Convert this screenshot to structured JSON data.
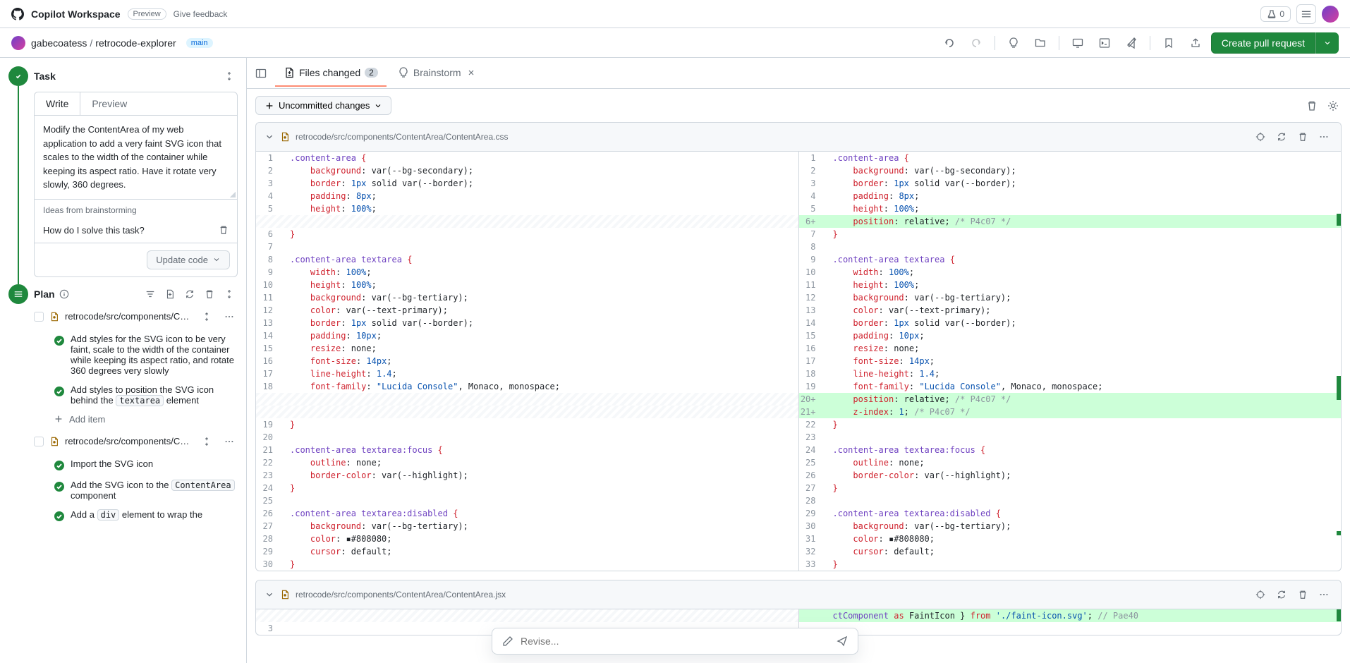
{
  "topbar": {
    "product": "Copilot Workspace",
    "preview_badge": "Preview",
    "feedback": "Give feedback",
    "experiments_count": "0"
  },
  "repo": {
    "owner": "gabecoatess",
    "name": "retrocode-explorer",
    "branch": "main",
    "pr_button": "Create pull request"
  },
  "task": {
    "section_label": "Task",
    "tab_write": "Write",
    "tab_preview": "Preview",
    "body": "Modify the ContentArea of my web application to add a very faint SVG icon that scales to the width of the container while keeping its aspect ratio. Have it rotate very slowly, 360 degrees.",
    "ideas_header": "Ideas from brainstorming",
    "idea_1": "How do I solve this task?",
    "update_code": "Update code"
  },
  "plan": {
    "section_label": "Plan",
    "files": [
      {
        "path": "retrocode/src/components/Content/",
        "items": [
          {
            "text_before": "Add styles for the SVG icon to be very faint, scale to the width of the container while keeping its aspect ratio, and rotate 360 degrees very slowly"
          },
          {
            "text_before": "Add styles to position the SVG icon behind the ",
            "code": "textarea",
            "text_after": " element"
          }
        ]
      },
      {
        "path": "retrocode/src/components/Content/",
        "items": [
          {
            "text_before": "Import the SVG icon"
          },
          {
            "text_before": "Add the SVG icon to the ",
            "code": "ContentArea",
            "text_after": " component"
          },
          {
            "text_before": "Add a ",
            "code": "div",
            "text_after": " element to wrap the"
          }
        ]
      }
    ],
    "add_item": "Add item"
  },
  "right": {
    "tab_files": "Files changed",
    "tab_files_count": "2",
    "tab_brainstorm": "Brainstorm",
    "uncommitted": "Uncommitted changes",
    "file1_path": "retrocode/src/components/ContentArea/ContentArea.css",
    "file2_path": "retrocode/src/components/ContentArea/ContentArea.jsx",
    "revise_placeholder": "Revise..."
  },
  "diff_file1": {
    "left": [
      {
        "n": 1,
        "html": "<span class='css-sel'>.content-area</span> <span class='css-brace-red'>{</span>"
      },
      {
        "n": 2,
        "html": "    <span class='css-prop'>background</span>: var(--bg-secondary);"
      },
      {
        "n": 3,
        "html": "    <span class='css-prop'>border</span>: <span class='css-num'>1px</span> solid var(--border);"
      },
      {
        "n": 4,
        "html": "    <span class='css-prop'>padding</span>: <span class='css-num'>8px</span>;"
      },
      {
        "n": 5,
        "html": "    <span class='css-prop'>height</span>: <span class='css-num'>100%</span>;"
      },
      {
        "n": "",
        "html": "",
        "hunk": true
      },
      {
        "n": 6,
        "html": "<span class='css-brace-red'>}</span>"
      },
      {
        "n": 7,
        "html": ""
      },
      {
        "n": 8,
        "html": "<span class='css-sel'>.content-area textarea</span> <span class='css-brace-red'>{</span>"
      },
      {
        "n": 9,
        "html": "    <span class='css-prop'>width</span>: <span class='css-num'>100%</span>;"
      },
      {
        "n": 10,
        "html": "    <span class='css-prop'>height</span>: <span class='css-num'>100%</span>;"
      },
      {
        "n": 11,
        "html": "    <span class='css-prop'>background</span>: var(--bg-tertiary);"
      },
      {
        "n": 12,
        "html": "    <span class='css-prop'>color</span>: var(--text-primary);"
      },
      {
        "n": 13,
        "html": "    <span class='css-prop'>border</span>: <span class='css-num'>1px</span> solid var(--border);"
      },
      {
        "n": 14,
        "html": "    <span class='css-prop'>padding</span>: <span class='css-num'>10px</span>;"
      },
      {
        "n": 15,
        "html": "    <span class='css-prop'>resize</span>: none;"
      },
      {
        "n": 16,
        "html": "    <span class='css-prop'>font-size</span>: <span class='css-num'>14px</span>;"
      },
      {
        "n": 17,
        "html": "    <span class='css-prop'>line-height</span>: <span class='css-num'>1.4</span>;"
      },
      {
        "n": 18,
        "html": "    <span class='css-prop'>font-family</span>: <span class='css-val'>\"Lucida Console\"</span>, Monaco, monospace;"
      },
      {
        "n": "",
        "html": "",
        "hunk": true
      },
      {
        "n": "",
        "html": "",
        "hunk": true
      },
      {
        "n": 19,
        "html": "<span class='css-brace-red'>}</span>"
      },
      {
        "n": 20,
        "html": ""
      },
      {
        "n": 21,
        "html": "<span class='css-sel'>.content-area textarea:focus</span> <span class='css-brace-red'>{</span>"
      },
      {
        "n": 22,
        "html": "    <span class='css-prop'>outline</span>: none;"
      },
      {
        "n": 23,
        "html": "    <span class='css-prop'>border-color</span>: var(--highlight);"
      },
      {
        "n": 24,
        "html": "<span class='css-brace-red'>}</span>"
      },
      {
        "n": 25,
        "html": ""
      },
      {
        "n": 26,
        "html": "<span class='css-sel'>.content-area textarea:disabled</span> <span class='css-brace-red'>{</span>"
      },
      {
        "n": 27,
        "html": "    <span class='css-prop'>background</span>: var(--bg-tertiary);"
      },
      {
        "n": 28,
        "html": "    <span class='css-prop'>color</span>: ▪#808080;"
      },
      {
        "n": 29,
        "html": "    <span class='css-prop'>cursor</span>: default;"
      },
      {
        "n": 30,
        "html": "<span class='css-brace-red'>}</span>"
      }
    ],
    "right": [
      {
        "n": 1,
        "html": "<span class='css-sel'>.content-area</span> <span class='css-brace-red'>{</span>"
      },
      {
        "n": 2,
        "html": "    <span class='css-prop'>background</span>: var(--bg-secondary);"
      },
      {
        "n": 3,
        "html": "    <span class='css-prop'>border</span>: <span class='css-num'>1px</span> solid var(--border);"
      },
      {
        "n": 4,
        "html": "    <span class='css-prop'>padding</span>: <span class='css-num'>8px</span>;"
      },
      {
        "n": 5,
        "html": "    <span class='css-prop'>height</span>: <span class='css-num'>100%</span>;"
      },
      {
        "n": "6+",
        "html": "    <span class='css-prop'>position</span>: relative; <span class='css-comment'>/* P4c07 */</span>",
        "add": true
      },
      {
        "n": 7,
        "html": "<span class='css-brace-red'>}</span>"
      },
      {
        "n": 8,
        "html": ""
      },
      {
        "n": 9,
        "html": "<span class='css-sel'>.content-area textarea</span> <span class='css-brace-red'>{</span>"
      },
      {
        "n": 10,
        "html": "    <span class='css-prop'>width</span>: <span class='css-num'>100%</span>;"
      },
      {
        "n": 11,
        "html": "    <span class='css-prop'>height</span>: <span class='css-num'>100%</span>;"
      },
      {
        "n": 12,
        "html": "    <span class='css-prop'>background</span>: var(--bg-tertiary);"
      },
      {
        "n": 13,
        "html": "    <span class='css-prop'>color</span>: var(--text-primary);"
      },
      {
        "n": 14,
        "html": "    <span class='css-prop'>border</span>: <span class='css-num'>1px</span> solid var(--border);"
      },
      {
        "n": 15,
        "html": "    <span class='css-prop'>padding</span>: <span class='css-num'>10px</span>;"
      },
      {
        "n": 16,
        "html": "    <span class='css-prop'>resize</span>: none;"
      },
      {
        "n": 17,
        "html": "    <span class='css-prop'>font-size</span>: <span class='css-num'>14px</span>;"
      },
      {
        "n": 18,
        "html": "    <span class='css-prop'>line-height</span>: <span class='css-num'>1.4</span>;"
      },
      {
        "n": 19,
        "html": "    <span class='css-prop'>font-family</span>: <span class='css-val'>\"Lucida Console\"</span>, Monaco, monospace;"
      },
      {
        "n": "20+",
        "html": "    <span class='css-prop'>position</span>: relative; <span class='css-comment'>/* P4c07 */</span>",
        "add": true
      },
      {
        "n": "21+",
        "html": "    <span class='css-prop'>z-index</span>: <span class='css-num'>1</span>; <span class='css-comment'>/* P4c07 */</span>",
        "add": true
      },
      {
        "n": 22,
        "html": "<span class='css-brace-red'>}</span>"
      },
      {
        "n": 23,
        "html": ""
      },
      {
        "n": 24,
        "html": "<span class='css-sel'>.content-area textarea:focus</span> <span class='css-brace-red'>{</span>"
      },
      {
        "n": 25,
        "html": "    <span class='css-prop'>outline</span>: none;"
      },
      {
        "n": 26,
        "html": "    <span class='css-prop'>border-color</span>: var(--highlight);"
      },
      {
        "n": 27,
        "html": "<span class='css-brace-red'>}</span>"
      },
      {
        "n": 28,
        "html": ""
      },
      {
        "n": 29,
        "html": "<span class='css-sel'>.content-area textarea:disabled</span> <span class='css-brace-red'>{</span>"
      },
      {
        "n": 30,
        "html": "    <span class='css-prop'>background</span>: var(--bg-tertiary);"
      },
      {
        "n": 31,
        "html": "    <span class='css-prop'>color</span>: ▪#808080;"
      },
      {
        "n": 32,
        "html": "    <span class='css-prop'>cursor</span>: default;"
      },
      {
        "n": 33,
        "html": "<span class='css-brace-red'>}</span>"
      }
    ]
  },
  "diff_file2": {
    "right_line": "<span class='css-sel'>ctComponent</span> <span class='css-prop'>as</span> FaintIcon } <span class='css-prop'>from</span> <span class='css-val'>'./faint-icon.svg'</span>; <span class='css-comment'>// Pae40</span>"
  }
}
